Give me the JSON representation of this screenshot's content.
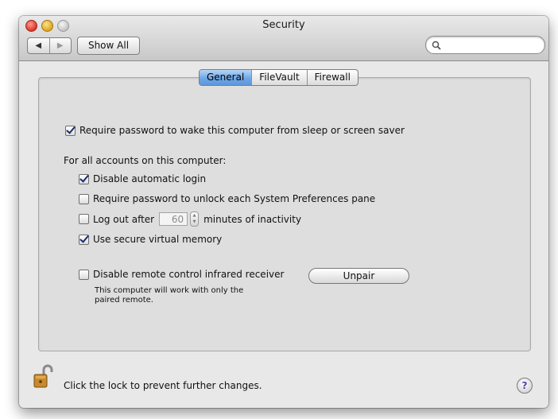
{
  "window": {
    "title": "Security"
  },
  "toolbar": {
    "back_icon": "triangle-left",
    "forward_icon": "triangle-right",
    "show_all_label": "Show All",
    "search_value": "",
    "search_placeholder": ""
  },
  "tabs": [
    {
      "label": "General",
      "active": true
    },
    {
      "label": "FileVault",
      "active": false
    },
    {
      "label": "Firewall",
      "active": false
    }
  ],
  "general": {
    "require_password_wake": {
      "label": "Require password to wake this computer from sleep or screen saver",
      "checked": true
    },
    "all_accounts_heading": "For all accounts on this computer:",
    "disable_auto_login": {
      "label": "Disable automatic login",
      "checked": true
    },
    "require_password_prefs": {
      "label": "Require password to unlock each System Preferences pane",
      "checked": false
    },
    "logout_after": {
      "label": "Log out after",
      "checked": false,
      "value": "60",
      "suffix": "minutes of inactivity"
    },
    "secure_vm": {
      "label": "Use secure virtual memory",
      "checked": true
    },
    "disable_ir": {
      "label": "Disable remote control infrared receiver",
      "checked": false
    },
    "ir_note": "This computer will work with only the paired remote.",
    "unpair_label": "Unpair"
  },
  "footer": {
    "lock_text": "Click the lock to prevent further changes.",
    "lock_state": "unlocked",
    "help_label": "?"
  },
  "colors": {
    "tab_active": "#6ea7e6",
    "window_bg": "#e8e8e8",
    "checkmark": "#1b2d6b"
  }
}
